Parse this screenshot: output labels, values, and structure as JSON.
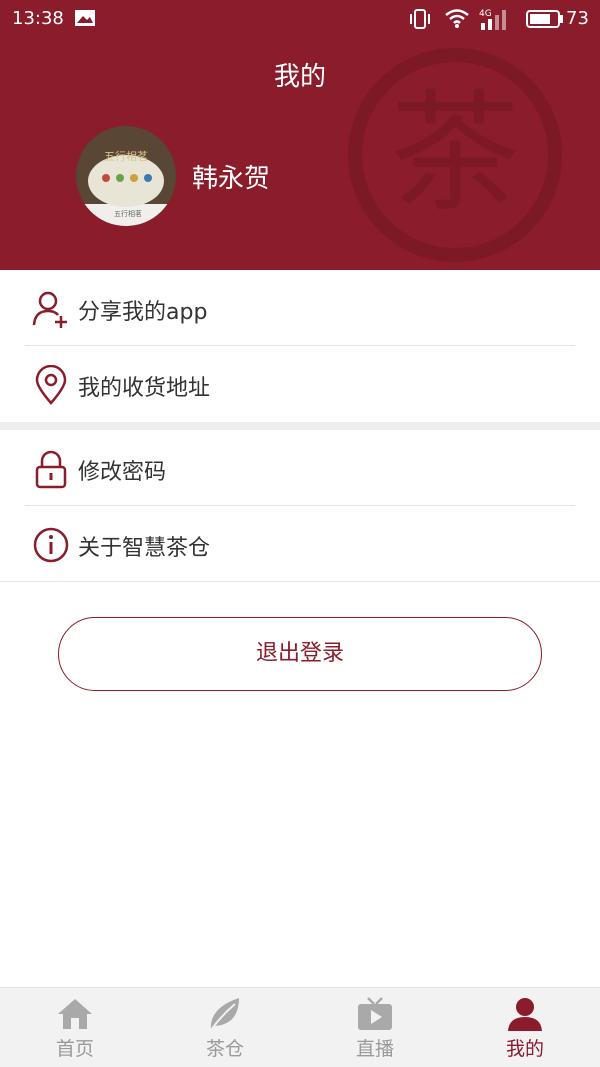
{
  "status_bar": {
    "time": "13:38",
    "battery": "73",
    "signal_type": "4G"
  },
  "header": {
    "title": "我的",
    "watermark_char": "茶"
  },
  "profile": {
    "username": "韩永贺",
    "avatar_text": "五行相茗",
    "avatar_caption": "五行相茗"
  },
  "menu": [
    {
      "label": "分享我的app",
      "icon": "add-user-icon"
    },
    {
      "label": "我的收货地址",
      "icon": "location-pin-icon"
    },
    {
      "label": "修改密码",
      "icon": "lock-icon"
    },
    {
      "label": "关于智慧茶仓",
      "icon": "info-icon"
    }
  ],
  "logout_label": "退出登录",
  "tabs": [
    {
      "label": "首页",
      "icon": "home-icon",
      "active": false
    },
    {
      "label": "茶仓",
      "icon": "leaf-icon",
      "active": false
    },
    {
      "label": "直播",
      "icon": "tv-play-icon",
      "active": false
    },
    {
      "label": "我的",
      "icon": "user-icon",
      "active": true
    }
  ],
  "colors": {
    "brand": "#8a1c2b",
    "inactive": "#9a9a9a",
    "background": "#ffffff"
  }
}
